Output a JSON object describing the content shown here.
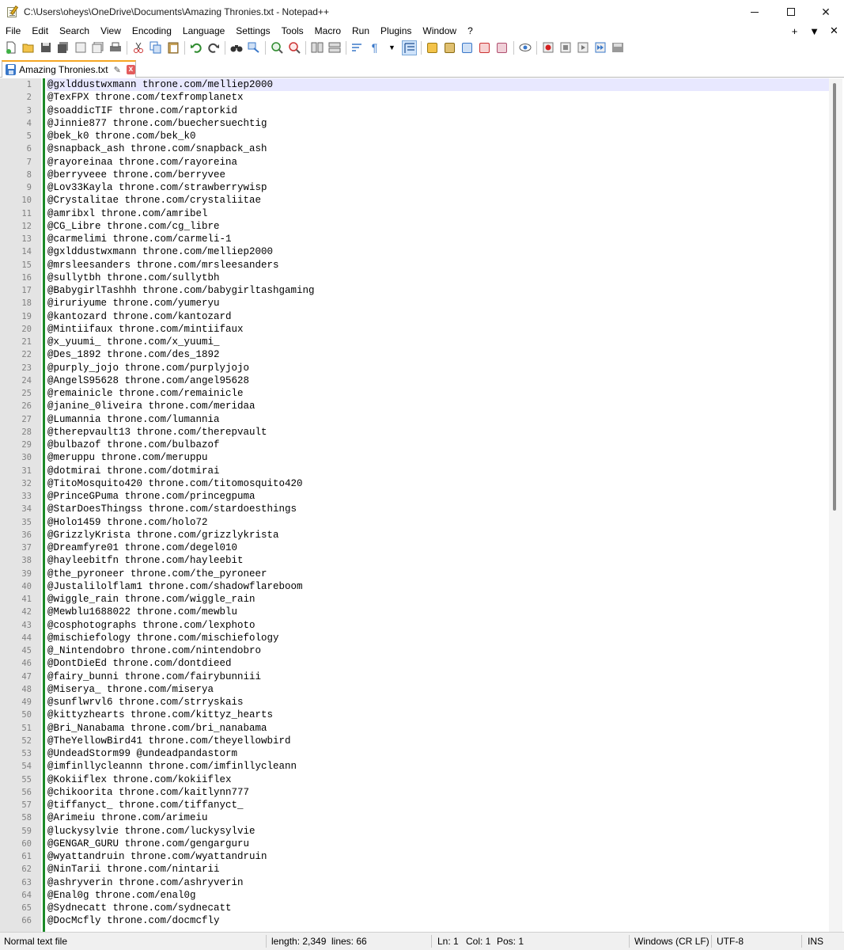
{
  "window": {
    "title": "C:\\Users\\oheys\\OneDrive\\Documents\\Amazing Thronies.txt - Notepad++",
    "minimize_label": "—",
    "close_label": "✕"
  },
  "menu": {
    "items": [
      "File",
      "Edit",
      "Search",
      "View",
      "Encoding",
      "Language",
      "Settings",
      "Tools",
      "Macro",
      "Run",
      "Plugins",
      "Window",
      "?"
    ],
    "right": [
      "+",
      "▼",
      "✕"
    ]
  },
  "tab": {
    "label": "Amazing Thronies.txt",
    "pin": "✎",
    "close": "x"
  },
  "editor": {
    "lines": [
      "@gxlddustwxmann throne.com/melliep2000",
      "@TexFPX throne.com/texfromplanetx",
      "@soaddicTIF throne.com/raptorkid",
      "@Jinnie877 throne.com/buechersuechtig",
      "@bek_k0 throne.com/bek_k0",
      "@snapback_ash throne.com/snapback_ash",
      "@rayoreinaa throne.com/rayoreina",
      "@berryveee throne.com/berryvee",
      "@Lov33Kayla throne.com/strawberrywisp",
      "@Crystalitae throne.com/crystaliitae",
      "@amribxl throne.com/amribel",
      "@CG_Libre throne.com/cg_libre",
      "@carmelimi throne.com/carmeli-1",
      "@gxlddustwxmann throne.com/melliep2000",
      "@mrsleesanders throne.com/mrsleesanders",
      "@sullytbh throne.com/sullytbh",
      "@BabygirlTashhh throne.com/babygirltashgaming",
      "@iruriyume throne.com/yumeryu",
      "@kantozard throne.com/kantozard",
      "@Mintiifaux throne.com/mintiifaux",
      "@x_yuumi_ throne.com/x_yuumi_",
      "@Des_1892 throne.com/des_1892",
      "@purply_jojo throne.com/purplyjojo",
      "@AngelS95628 throne.com/angel95628",
      "@remainicle throne.com/remainicle",
      "@janine_0liveira throne.com/meridaa",
      "@Lumannia throne.com/lumannia",
      "@therepvault13 throne.com/therepvault",
      "@bulbazof throne.com/bulbazof",
      "@meruppu throne.com/meruppu",
      "@dotmirai throne.com/dotmirai",
      "@TitoMosquito420 throne.com/titomosquito420",
      "@PrinceGPuma throne.com/princegpuma",
      "@StarDoesThingss throne.com/stardoesthings",
      "@Holo1459 throne.com/holo72",
      "@GrizzlyKrista throne.com/grizzlykrista",
      "@Dreamfyre01 throne.com/degel010",
      "@hayleebitfn throne.com/hayleebit",
      "@the_pyroneer throne.com/the_pyroneer",
      "@Justalilolflam1 throne.com/shadowflareboom",
      "@wiggle_rain throne.com/wiggle_rain",
      "@Mewblu1688022 throne.com/mewblu",
      "@cosphotographs throne.com/lexphoto",
      "@mischiefology throne.com/mischiefology",
      "@_Nintendobro throne.com/nintendobro",
      "@DontDieEd throne.com/dontdieed",
      "@fairy_bunni throne.com/fairybunniii",
      "@Miserya_ throne.com/miserya",
      "@sunflwrvl6 throne.com/strryskais",
      "@kittyzhearts throne.com/kittyz_hearts",
      "@Bri_Nanabama throne.com/bri_nanabama",
      "@TheYellowBird41 throne.com/theyellowbird",
      "@UndeadStorm99 @undeadpandastorm",
      "@imfinllycleannn throne.com/imfinllycleann",
      "@Kokiiflex throne.com/kokiiflex",
      "@chikoorita throne.com/kaitlynn777",
      "@tiffanyct_ throne.com/tiffanyct_",
      "@Arimeiu throne.com/arimeiu",
      "@luckysylvie throne.com/luckysylvie",
      "@GENGAR_GURU throne.com/gengarguru",
      "@wyattandruin throne.com/wyattandruin",
      "@NinTarii throne.com/nintarii",
      "@ashryverin throne.com/ashryverin",
      "@Enal0g throne.com/enal0g",
      "@Sydnecatt throne.com/sydnecatt",
      "@DocMcfly throne.com/docmcfly"
    ]
  },
  "status": {
    "file_type": "Normal text file",
    "length": "length: 2,349",
    "lines": "lines: 66",
    "ln": "Ln: 1",
    "col": "Col: 1",
    "pos": "Pos: 1",
    "eol": "Windows (CR LF)",
    "encoding": "UTF-8",
    "mode": "INS"
  },
  "colors": {
    "tab_accent": "#f5a623",
    "change_bar": "#1b8a27",
    "current_line": "#e8e8ff",
    "gutter": "#e4e4e4"
  }
}
